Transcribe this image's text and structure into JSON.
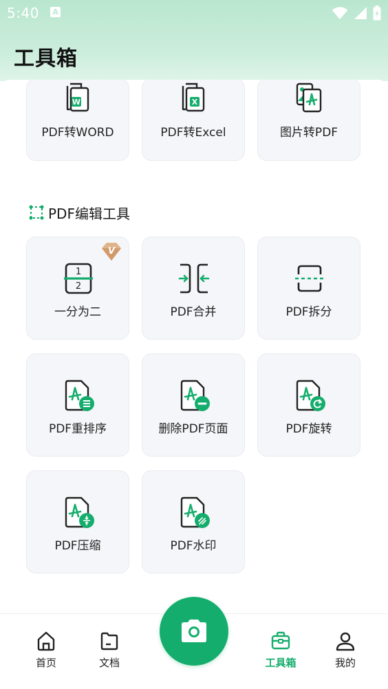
{
  "status_bar": {
    "time": "5:40",
    "notification_icon": "A"
  },
  "header": {
    "title": "工具箱"
  },
  "convert_tools": [
    {
      "label": "PDF转WORD",
      "icon": "pdf-to-word-icon",
      "badge": "W"
    },
    {
      "label": "PDF转Excel",
      "icon": "pdf-to-excel-icon",
      "badge": "X"
    },
    {
      "label": "图片转PDF",
      "icon": "image-to-pdf-icon"
    }
  ],
  "edit_section": {
    "title": "PDF编辑工具",
    "vip_badge": "V",
    "tools": [
      {
        "label": "一分为二",
        "icon": "split-in-two-icon",
        "digit_top": "1",
        "digit_bottom": "2",
        "vip": true
      },
      {
        "label": "PDF合并",
        "icon": "merge-icon"
      },
      {
        "label": "PDF拆分",
        "icon": "split-icon"
      },
      {
        "label": "PDF重排序",
        "icon": "reorder-icon"
      },
      {
        "label": "删除PDF页面",
        "icon": "delete-page-icon"
      },
      {
        "label": "PDF旋转",
        "icon": "rotate-icon"
      },
      {
        "label": "PDF压缩",
        "icon": "compress-icon"
      },
      {
        "label": "PDF水印",
        "icon": "watermark-icon"
      }
    ]
  },
  "bottom_nav": {
    "items": [
      {
        "label": "首页",
        "icon": "home-icon"
      },
      {
        "label": "文档",
        "icon": "folder-icon"
      },
      {
        "label": "工具箱",
        "icon": "toolbox-icon",
        "active": true
      },
      {
        "label": "我的",
        "icon": "profile-icon"
      }
    ],
    "camera_icon": "camera-icon"
  },
  "colors": {
    "accent": "#15ad6d",
    "vip": "#d9a77a",
    "text": "#222222"
  }
}
